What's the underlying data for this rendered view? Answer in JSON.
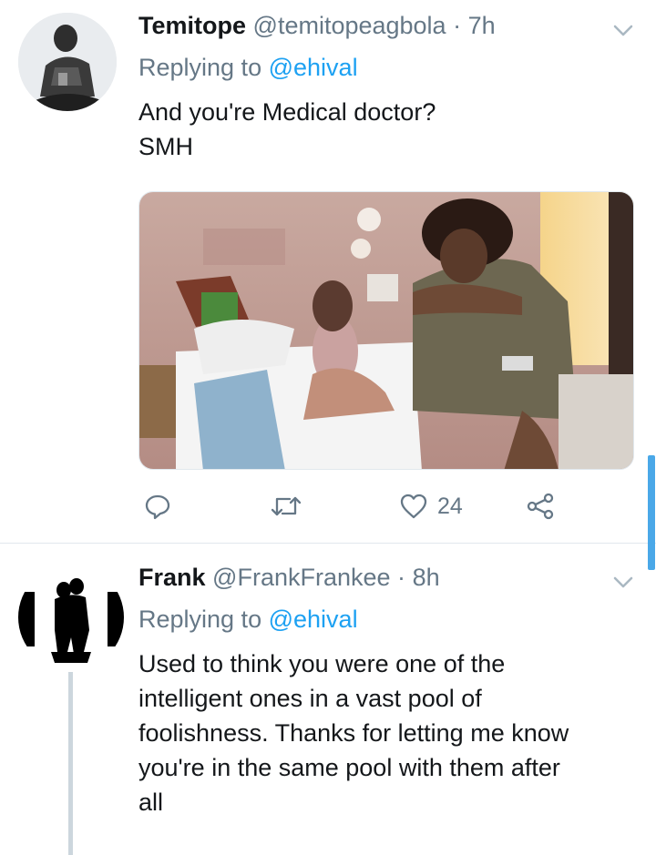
{
  "tweets": [
    {
      "name": "Temitope",
      "handle": "@temitopeagbola",
      "dot": "·",
      "time": "7h",
      "replying_prefix": "Replying to",
      "replying_to": "@ehival",
      "text_lines": [
        "And you're Medical doctor?",
        "SMH"
      ],
      "actions": {
        "reply_count": "",
        "retweet_count": "",
        "like_count": "24"
      }
    },
    {
      "name": "Frank",
      "handle": "@FrankFrankee",
      "dot": "·",
      "time": "8h",
      "replying_prefix": "Replying to",
      "replying_to": "@ehival",
      "text_lines": [
        "Used to think you were one of the",
        "intelligent ones in a vast pool of",
        "foolishness. Thanks for letting me know",
        "you're in the same pool with them after",
        "all"
      ]
    }
  ],
  "icons": {
    "reply": "reply-icon",
    "retweet": "retweet-icon",
    "like": "heart-icon",
    "share": "share-icon",
    "more": "chevron-down-icon"
  },
  "colors": {
    "accent": "#1da1f2",
    "secondary_text": "#657786",
    "primary_text": "#14171a",
    "divider": "#e1e8ed",
    "scrollbar": "#4aa8e8"
  }
}
